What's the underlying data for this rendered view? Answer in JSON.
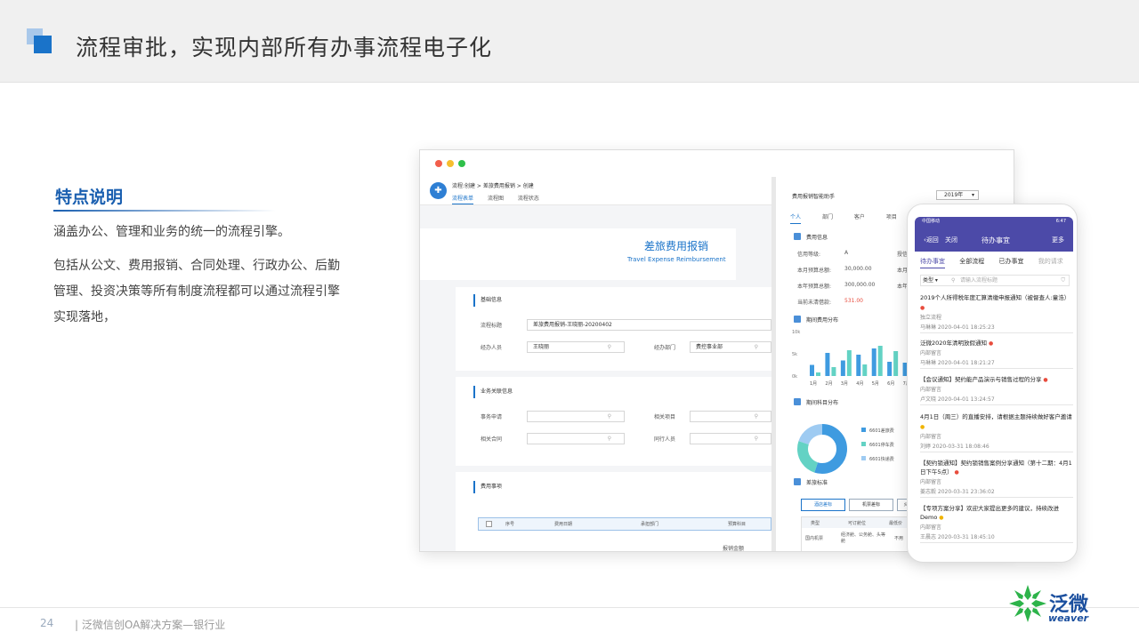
{
  "header": {
    "title": "流程审批，实现内部所有办事流程电子化"
  },
  "features": {
    "title": "特点说明",
    "p1": "涵盖办公、管理和业务的统一的流程引擎。",
    "p2": "包括从公文、费用报销、合同处理、行政办公、后勤管理、投资决策等所有制度流程都可以通过流程引擎实现落地，"
  },
  "desktop": {
    "breadcrumb": "流程:创建 > 差旅费用报销 > 创建",
    "tabs": [
      "流程表单",
      "流程图",
      "流程状态"
    ],
    "form_title_cn": "差旅费用报销",
    "form_title_en": "Travel Expense Reimbursement",
    "sections": {
      "basic": "基础信息",
      "related": "业务关联信息",
      "expense": "费用事项"
    },
    "fields": {
      "title_label": "流程标题",
      "title_value": "差旅费用报销-王晓丽-20200402",
      "handler_label": "经办人员",
      "handler_value": "王晓丽",
      "dept_label": "经办部门",
      "dept_value": "费控事业部",
      "request_label": "事务申请",
      "project_label": "相关项目",
      "contract_label": "相关合同",
      "companion_label": "同行人员"
    },
    "expense_table": {
      "headers": [
        "序号",
        "费用日期",
        "承担部门",
        "预算科目"
      ],
      "footer_label": "报销金额"
    },
    "assistant": {
      "title": "费用报销智能助手",
      "year": "2019年",
      "tabs": [
        "个人",
        "部门",
        "客户",
        "项目"
      ],
      "info_section": "费用信息",
      "rows": [
        {
          "label": "信用等级:",
          "value": "A",
          "extra": "授信"
        },
        {
          "label": "本月预算总额:",
          "value": "30,000.00",
          "extra": "本月"
        },
        {
          "label": "本年预算总额:",
          "value": "300,000.00",
          "extra": "本年"
        },
        {
          "label": "当前未清借款:",
          "value": "531.00",
          "extra": ""
        }
      ],
      "period_section": "期间费用分布",
      "subject_section": "期间科目分布",
      "standard_section": "差旅标准",
      "legend": [
        "6601差旅费",
        "6601停车费",
        "6601快递费"
      ],
      "std_buttons": [
        "酒店差标",
        "机票差标",
        "火"
      ],
      "std_headers": [
        "类型",
        "可订舱位",
        "最低价"
      ],
      "std_row": [
        "国内机票",
        "经济舱、公务舱、头等舱",
        "不用"
      ]
    }
  },
  "chart_data": {
    "type": "bar",
    "categories": [
      "1月",
      "2月",
      "3月",
      "4月",
      "5月",
      "6月",
      "7月"
    ],
    "series": [
      {
        "values": [
          2.5,
          5.2,
          3.5,
          4.8,
          6.2,
          3.2,
          3.0
        ]
      },
      {
        "values": [
          0.8,
          2.0,
          5.8,
          2.6,
          6.8,
          5.6,
          4.2
        ]
      }
    ],
    "yticks": [
      "10k",
      "5k",
      "0k"
    ],
    "ylim": [
      0,
      10
    ]
  },
  "donut_data": {
    "type": "pie",
    "values": [
      55,
      25,
      20
    ],
    "colors": [
      "#3f9be0",
      "#63d2c4",
      "#9ecbf2"
    ]
  },
  "phone": {
    "status_left": "中国移动",
    "status_right": "6:47",
    "back": "返回",
    "close": "关闭",
    "title": "待办事宜",
    "more": "更多",
    "tabs": [
      "待办事宜",
      "全部流程",
      "已办事宜",
      "我的请求"
    ],
    "filter_label": "类型",
    "search_placeholder": "请输入流程标题",
    "items": [
      {
        "title": "2019个人所得税年度汇算清缴申报通知（被督查人:童浩）",
        "type": "独立流程",
        "meta": "马琳琳 2020-04-01 18:25:23"
      },
      {
        "title": "泛微2020年清明放假通知",
        "type": "内部留言",
        "meta": "马琳琳 2020-04-01 18:21:27"
      },
      {
        "title": "【会议通知】契约能产品演示与销售过程的分享",
        "type": "内部留言",
        "meta": "卢文晓 2020-04-01 13:24:57"
      },
      {
        "title": "4月1日（周三）的直播安排，请根据主题持续做好客户邀请",
        "type": "内部留言",
        "meta": "刘婷 2020-03-31 18:08:46"
      },
      {
        "title": "【契约锁通知】契约锁销售案例分享通知（第十二期：4月1日下午5点）",
        "type": "内部留言",
        "meta": "姜志毅 2020-03-31 23:36:02"
      },
      {
        "title": "【专项方案分享】欢迎大家提出更多的建议，持续改进Demo",
        "type": "内部留言",
        "meta": "王晨志 2020-03-31 18:45:10"
      }
    ]
  },
  "footer": {
    "page": "24",
    "text": "| 泛微信创OA解决方案—银行业",
    "brand_cn": "泛微",
    "brand_en": "weaver"
  },
  "colors": {
    "accent": "#1a73c9",
    "phone_nav": "#4c4aa8",
    "title_blue": "#1a5fb0"
  }
}
